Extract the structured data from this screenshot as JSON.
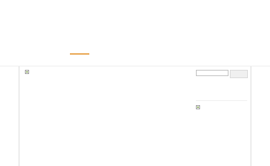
{
  "nav": {
    "active_indicator_color": "#e8a34a"
  },
  "search": {
    "value": "",
    "placeholder": "",
    "button_label": ""
  },
  "images": {
    "main_icon": "broken-image-icon",
    "side_icon": "broken-image-icon"
  }
}
